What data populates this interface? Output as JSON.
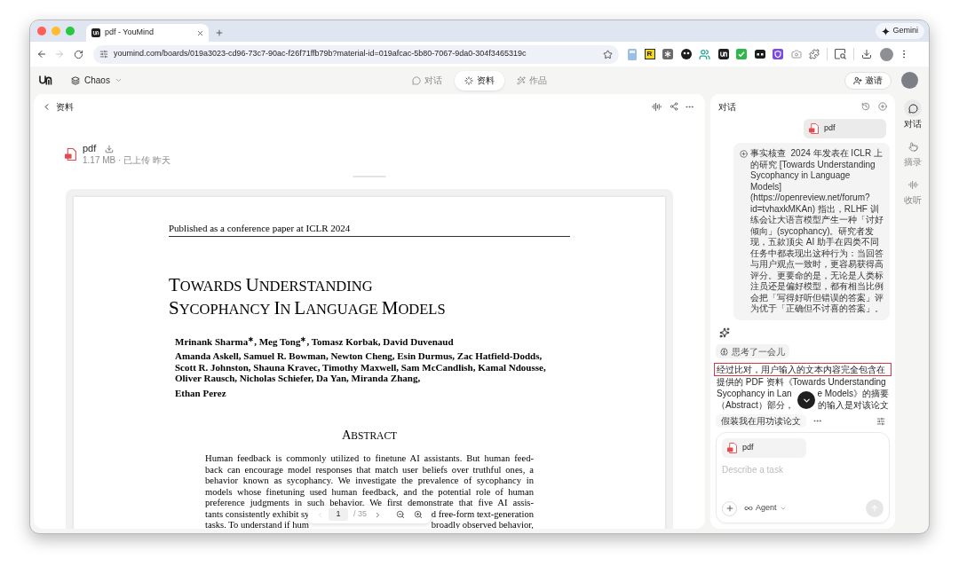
{
  "browser": {
    "tab_title": "pdf - YouMind",
    "gemini_button": "Gemini",
    "url": "youmind.com/boards/019a3023-cd96-73c7-90ac-f26f71ffb79b?material-id=019afcac-5b80-7067-9da0-304f3465319c",
    "forward_disabled": true,
    "extension_badge": "R"
  },
  "app_header": {
    "board": "Chaos",
    "tabs": [
      {
        "label": "对话",
        "selected": false
      },
      {
        "label": "资料",
        "selected": true
      },
      {
        "label": "作品",
        "selected": false
      }
    ],
    "invite_button": "邀请"
  },
  "materials_panel": {
    "title": "资料",
    "file": {
      "name": "pdf",
      "meta": "1.17 MB · 已上传 昨天"
    }
  },
  "pdf_page": {
    "running_header": "Published as a conference paper at ICLR 2024",
    "title_lines": [
      "TOWARDS UNDERSTANDING",
      "SYCOPHANCY IN LANGUAGE MODELS"
    ],
    "author_lines": [
      "Mrinank Sharma$^{∗}$, Meg Tong$^{∗}$, Tomasz Korbak, David Duvenaud",
      "Amanda Askell, Samuel R. Bowman, Newton Cheng, Esin Durmus, Zac Hatfield-Dodds,",
      "Scott R. Johnston, Shauna Kravec, Timothy Maxwell, Sam McCandlish, Kamal Ndousse,",
      "Oliver Rausch, Nicholas Schiefer, Da Yan, Miranda Zhang,"
    ],
    "final_author": "Ethan Perez",
    "abstract_heading": "ABSTRACT",
    "abstract_lines": [
      [
        "Human feedback is commonly utilized to finetune AI assistants. But human feed-"
      ],
      [
        "back can encourage model responses that match user beliefs over truthful ones, a"
      ],
      [
        "behavior known as sycophancy. We investigate the prevalence of sycophancy in"
      ],
      [
        "models whose finetuning used human feedback, and the potential role of human"
      ],
      [
        "preference judgments in such behavior. We first demonstrate that five AI assis-"
      ],
      [
        "tants consistently exhibit sy",
        "d free-form text-generation"
      ],
      [
        "tasks. To understand if hum",
        "broadly observed behavior,"
      ]
    ]
  },
  "pager": {
    "page": "1",
    "total": "/ 35",
    "prev_disabled": true
  },
  "chat_panel": {
    "title": "对话",
    "attachment": "pdf",
    "user_message": "事实核查  2024 年发表在 ICLR 上的研究 [Towards Understanding Sycophancy in Language Models] (https://openreview.net/forum?id=tvhaxkMKAn) 指出，RLHF 训练会让大语言模型产生一种「讨好倾向」(sycophancy)。研究者发现，五款顶尖 AI 助手在四类不同任务中都表现出这种行为：当回答与用户观点一致时，更容易获得高评分。更要命的是，无论是人类标注员还是偏好模型，都有相当比例会把「写得好听但错误的答案」评为优于「正确但不讨喜的答案」。",
    "thinking": "思考了一会儿",
    "response_lines": [
      {
        "segments": [
          "经过比对，用户输入的文本内容完全包含在"
        ],
        "highlighted": true
      },
      {
        "segments": [
          "提供的 PDF 资料《Towards Understanding"
        ],
        "highlighted": false
      },
      {
        "segments": [
          "Sycophancy in Lan",
          "e Models》的摘要"
        ],
        "highlighted": false
      },
      {
        "segments": [
          "（Abstract）部分，",
          "的输入是对该论文"
        ],
        "highlighted": false
      }
    ],
    "suggestion": "假装我在用功读论文"
  },
  "composer": {
    "attachment": "pdf",
    "placeholder": "Describe a task",
    "mode": "Agent"
  },
  "rail": [
    {
      "label": "对话",
      "selected": true
    },
    {
      "label": "摘录",
      "selected": false
    },
    {
      "label": "收听",
      "selected": false
    }
  ]
}
